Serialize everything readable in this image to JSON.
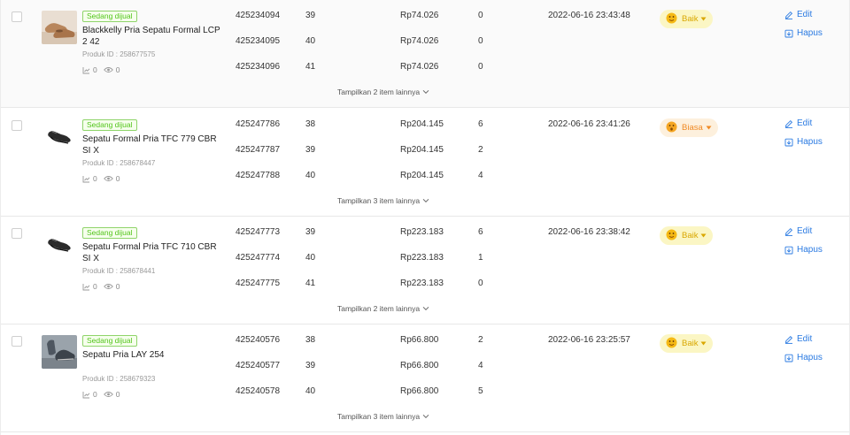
{
  "labels": {
    "product_id_prefix": "Produk ID : ",
    "edit": "Edit",
    "delete": "Hapus"
  },
  "colors": {
    "link": "#2a7ae2",
    "status_green": "#52c41a",
    "good_bg": "#fbf6c4",
    "good_text": "#d9a700",
    "fair_bg": "#fdf0dd",
    "fair_text": "#f08a24"
  },
  "products": [
    {
      "status": "Sedang dijual",
      "name": "Blackkelly Pria Sepatu Formal LCP 2 42",
      "product_id": "258677575",
      "chart_stat": "0",
      "views": "0",
      "image": "shoe-photo-brown",
      "variants": [
        {
          "sku": "425234094",
          "size": "39",
          "price": "Rp74.026",
          "stock": "0"
        },
        {
          "sku": "425234095",
          "size": "40",
          "price": "Rp74.026",
          "stock": "0"
        },
        {
          "sku": "425234096",
          "size": "41",
          "price": "Rp74.026",
          "stock": "0"
        }
      ],
      "more_label": "Tampilkan 2 item lainnya",
      "updated": "2022-06-16 23:43:48",
      "quality": "Baik",
      "quality_level": "good"
    },
    {
      "status": "Sedang dijual",
      "name": "Sepatu Formal Pria TFC 779 CBR SI X",
      "product_id": "258678447",
      "chart_stat": "0",
      "views": "0",
      "image": "shoe-photo-black",
      "variants": [
        {
          "sku": "425247786",
          "size": "38",
          "price": "Rp204.145",
          "stock": "6"
        },
        {
          "sku": "425247787",
          "size": "39",
          "price": "Rp204.145",
          "stock": "2"
        },
        {
          "sku": "425247788",
          "size": "40",
          "price": "Rp204.145",
          "stock": "4"
        }
      ],
      "more_label": "Tampilkan 3 item lainnya",
      "updated": "2022-06-16 23:41:26",
      "quality": "Biasa",
      "quality_level": "fair"
    },
    {
      "status": "Sedang dijual",
      "name": "Sepatu Formal Pria TFC 710 CBR SI X",
      "product_id": "258678441",
      "chart_stat": "0",
      "views": "0",
      "image": "shoe-photo-black",
      "variants": [
        {
          "sku": "425247773",
          "size": "39",
          "price": "Rp223.183",
          "stock": "6"
        },
        {
          "sku": "425247774",
          "size": "40",
          "price": "Rp223.183",
          "stock": "1"
        },
        {
          "sku": "425247775",
          "size": "41",
          "price": "Rp223.183",
          "stock": "0"
        }
      ],
      "more_label": "Tampilkan 2 item lainnya",
      "updated": "2022-06-16 23:38:42",
      "quality": "Baik",
      "quality_level": "good"
    },
    {
      "status": "Sedang dijual",
      "name": "Sepatu Pria LAY 254",
      "product_id": "258679323",
      "chart_stat": "0",
      "views": "0",
      "image": "shoe-photo-grey",
      "variants": [
        {
          "sku": "425240576",
          "size": "38",
          "price": "Rp66.800",
          "stock": "2"
        },
        {
          "sku": "425240577",
          "size": "39",
          "price": "Rp66.800",
          "stock": "4"
        },
        {
          "sku": "425240578",
          "size": "40",
          "price": "Rp66.800",
          "stock": "5"
        }
      ],
      "more_label": "Tampilkan 3 item lainnya",
      "updated": "2022-06-16 23:25:57",
      "quality": "Baik",
      "quality_level": "good"
    }
  ]
}
